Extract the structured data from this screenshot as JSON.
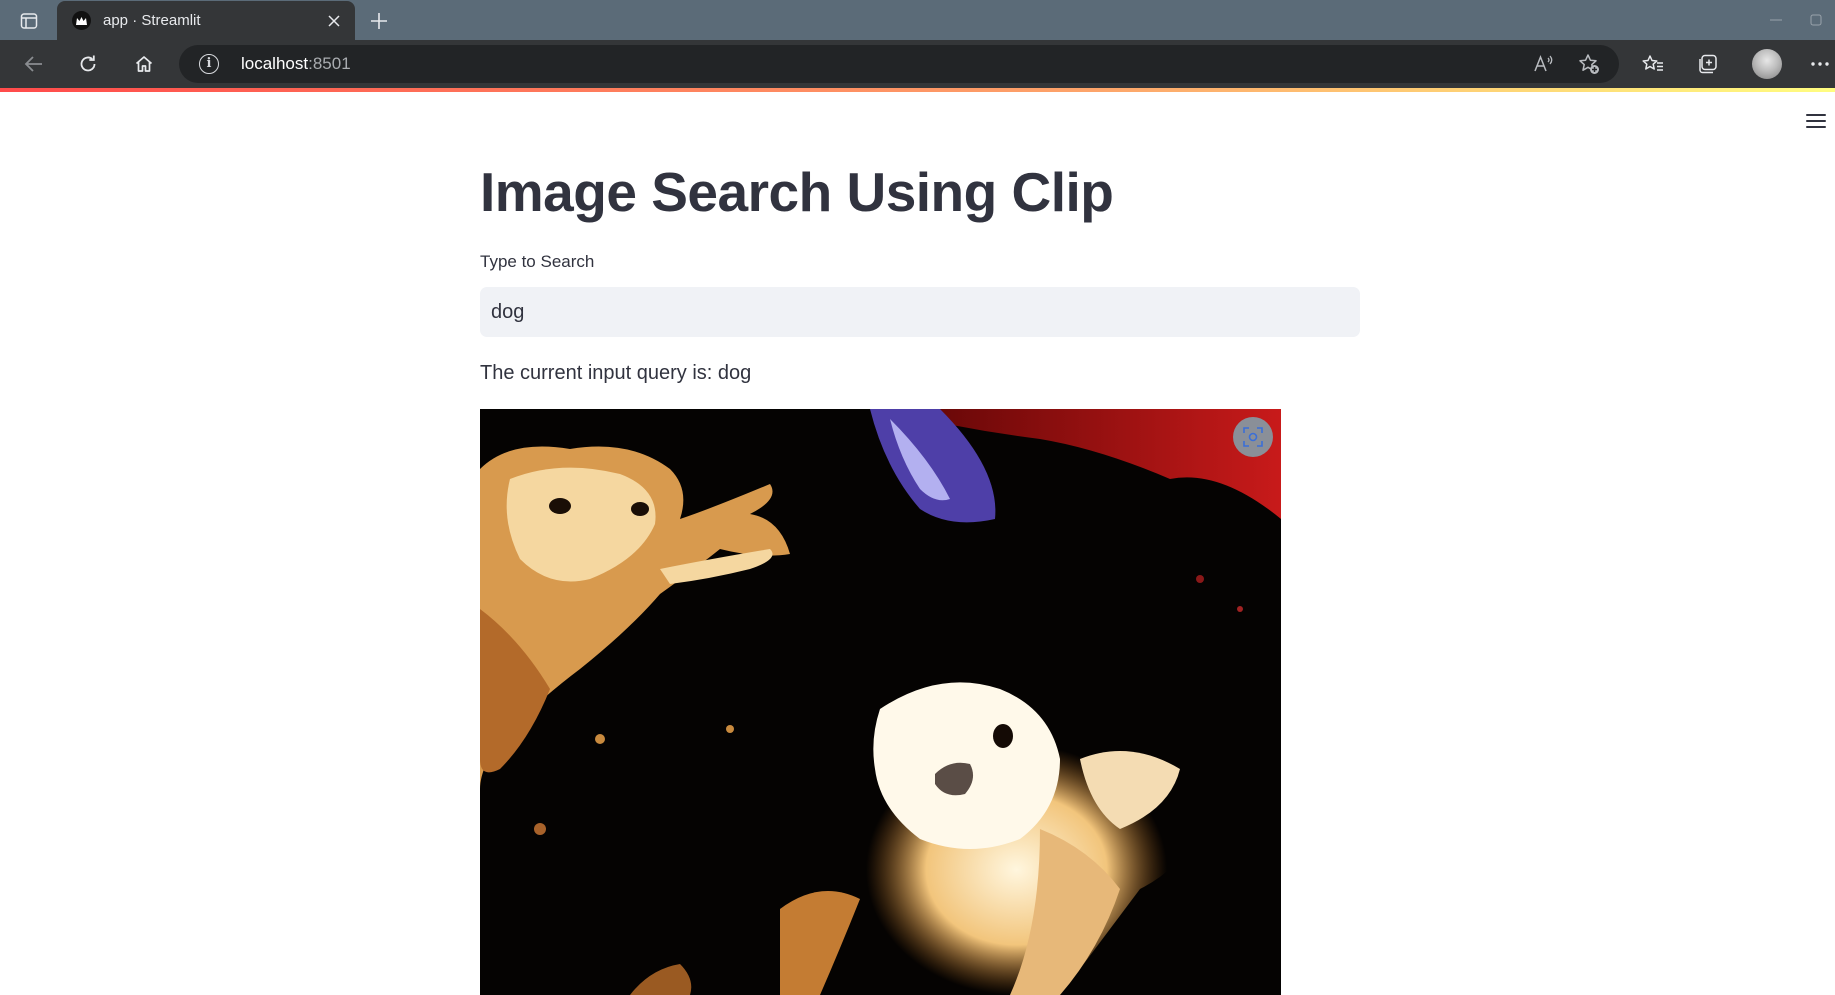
{
  "browser": {
    "tab_title": "app · Streamlit",
    "url_host": "localhost",
    "url_port": ":8501",
    "icons": [
      "tab-actions-icon",
      "streamlit-favicon-icon",
      "close-icon",
      "plus-icon",
      "minimize-icon",
      "restore-icon",
      "back-icon",
      "reload-icon",
      "home-icon",
      "info-icon",
      "read-aloud-icon",
      "add-favorite-icon",
      "favorites-icon",
      "collections-icon",
      "profile-avatar",
      "more-icon"
    ]
  },
  "app": {
    "menu_icon": "hamburger-menu-icon",
    "title": "Image Search Using Clip",
    "input_label": "Type to Search",
    "input_value": "dog",
    "query_text": "The current input query is: dog",
    "image_subject": "two golden dogs (posterized photo)",
    "fullscreen_icon": "fullscreen-icon",
    "accent_gradient": [
      "#ff4b4b",
      "#fda56a",
      "#fffd80"
    ],
    "text_color": "#31333f",
    "input_bg": "#f0f2f6"
  }
}
